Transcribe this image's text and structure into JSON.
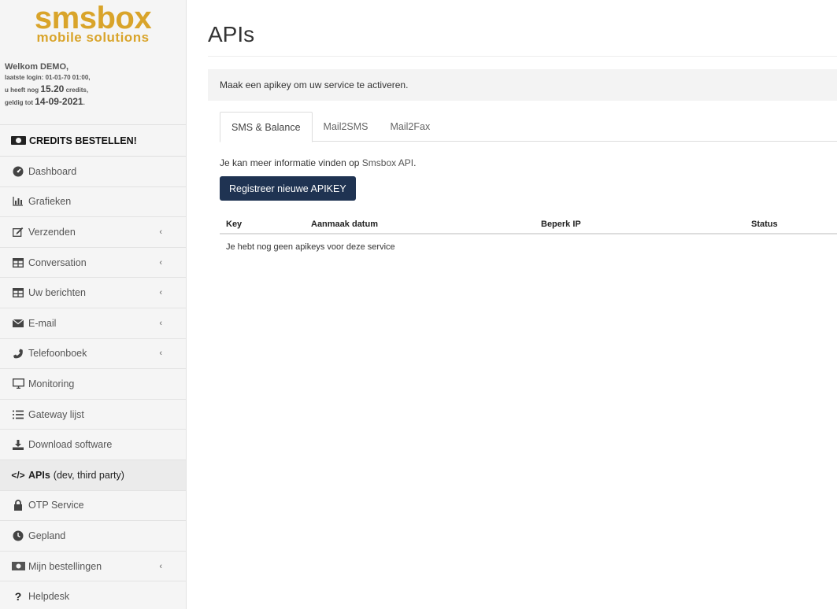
{
  "brand": {
    "name": "smsbox",
    "tagline": "mobile solutions"
  },
  "welcome": {
    "title": "Welkom DEMO,",
    "login_label": "laatste login: 01-01-70 01:00,",
    "credits_prefix": "u heeft nog ",
    "credits_value": "15.20",
    "credits_suffix": " credits,",
    "valid_prefix": "geldig tot ",
    "valid_date": "14-09-2021",
    "valid_suffix": "."
  },
  "credits_button": "CREDITS BESTELLEN!",
  "nav": [
    {
      "label": "Dashboard",
      "icon": "dashboard-icon"
    },
    {
      "label": "Grafieken",
      "icon": "chart-icon"
    },
    {
      "label": "Verzenden",
      "icon": "edit-icon",
      "chevron": "‹"
    },
    {
      "label": "Conversation",
      "icon": "table-icon",
      "chevron": "‹"
    },
    {
      "label": "Uw berichten",
      "icon": "table-icon",
      "chevron": "‹"
    },
    {
      "label": "E-mail",
      "icon": "envelope-icon",
      "chevron": "‹"
    },
    {
      "label": "Telefoonboek",
      "icon": "phone-icon",
      "chevron": "‹"
    },
    {
      "label": "Monitoring",
      "icon": "monitor-icon"
    },
    {
      "label": "Gateway lijst",
      "icon": "list-icon"
    },
    {
      "label": "Download software",
      "icon": "download-icon"
    },
    {
      "label_bold": "APIs",
      "label": "(dev, third party)",
      "icon": "code-icon",
      "active": true
    },
    {
      "label": "OTP Service",
      "icon": "lock-icon"
    },
    {
      "label": "Gepland",
      "icon": "clock-icon"
    },
    {
      "label": "Mijn bestellingen",
      "icon": "cash-icon",
      "chevron": "‹"
    },
    {
      "label": "Helpdesk",
      "icon": "question-icon"
    }
  ],
  "main": {
    "title": "APIs",
    "notice": "Maak een apikey om uw service te activeren.",
    "tabs": [
      "SMS & Balance",
      "Mail2SMS",
      "Mail2Fax"
    ],
    "info_prefix": "Je kan meer informatie vinden op ",
    "info_link": "Smsbox API",
    "info_suffix": ".",
    "register_button": "Registreer nieuwe APIKEY",
    "table": {
      "headers": [
        "Key",
        "Aanmaak datum",
        "Beperk IP",
        "Status"
      ],
      "empty": "Je hebt nog geen apikeys voor deze service"
    }
  },
  "colors": {
    "brand": "#d9a42a",
    "button": "#1f3352"
  }
}
